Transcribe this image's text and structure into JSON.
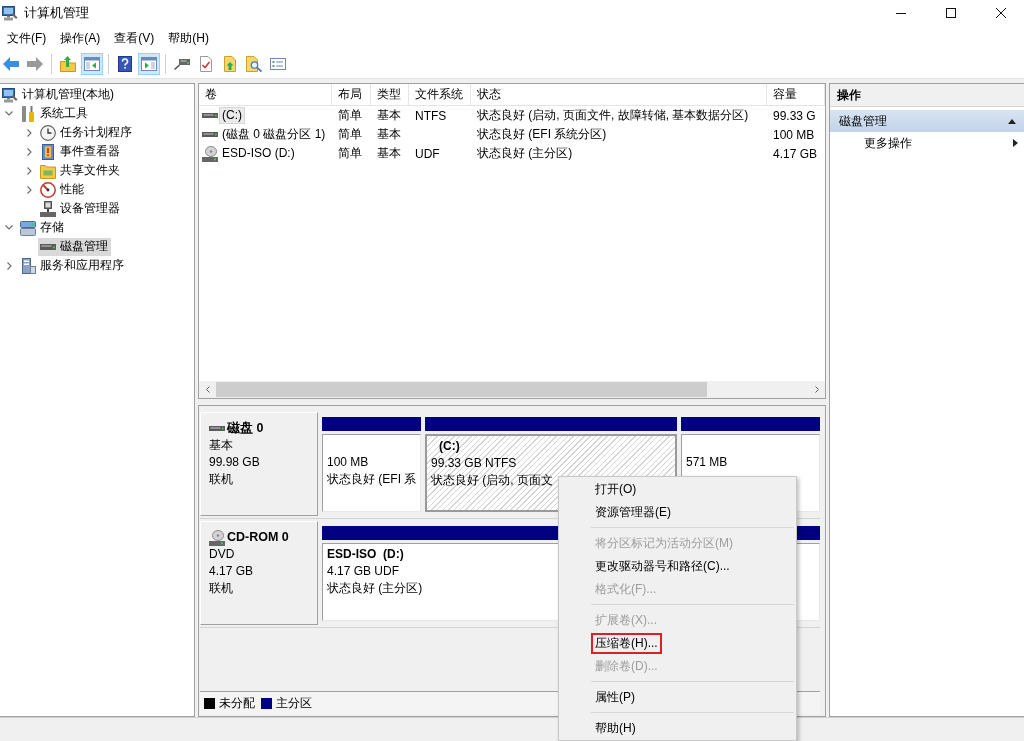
{
  "window": {
    "title": "计算机管理"
  },
  "menu_bar": [
    "文件(F)",
    "操作(A)",
    "查看(V)",
    "帮助(H)"
  ],
  "toolbar": [
    [
      {
        "kind": "back",
        "pressed": false,
        "disabled": false
      },
      {
        "kind": "forward",
        "pressed": false,
        "disabled": true
      }
    ],
    [
      {
        "kind": "up",
        "pressed": false,
        "disabled": false
      },
      {
        "kind": "console_tree",
        "pressed": true,
        "disabled": false
      }
    ],
    [
      {
        "kind": "help",
        "pressed": false,
        "disabled": false
      },
      {
        "kind": "action_pane",
        "pressed": true,
        "disabled": false
      }
    ],
    [
      {
        "kind": "connect",
        "pressed": false,
        "disabled": false
      },
      {
        "kind": "check",
        "pressed": false,
        "disabled": false
      },
      {
        "kind": "import",
        "pressed": false,
        "disabled": false
      },
      {
        "kind": "search",
        "pressed": false,
        "disabled": false
      },
      {
        "kind": "properties",
        "pressed": false,
        "disabled": false
      }
    ]
  ],
  "tree": [
    {
      "label": "计算机管理(本地)",
      "kind": "console",
      "selected": false,
      "children": [
        {
          "label": "系统工具",
          "kind": "tools",
          "selected": false,
          "expanded": true,
          "children": [
            {
              "label": "任务计划程序",
              "kind": "scheduler",
              "selected": false,
              "expanded": false
            },
            {
              "label": "事件查看器",
              "kind": "events",
              "selected": false,
              "expanded": false
            },
            {
              "label": "共享文件夹",
              "kind": "shares",
              "selected": false,
              "expanded": false
            },
            {
              "label": "性能",
              "kind": "performance",
              "selected": false,
              "expanded": false
            },
            {
              "label": "设备管理器",
              "kind": "devices",
              "selected": false
            }
          ]
        },
        {
          "label": "存储",
          "kind": "storage",
          "selected": false,
          "expanded": true,
          "children": [
            {
              "label": "磁盘管理",
              "kind": "disks",
              "selected": true
            }
          ]
        },
        {
          "label": "服务和应用程序",
          "kind": "services",
          "selected": false,
          "expanded": false
        }
      ]
    }
  ],
  "volume_table": {
    "columns": [
      "卷",
      "布局",
      "类型",
      "文件系统",
      "状态",
      "容量"
    ],
    "rows": [
      {
        "kind": "disk",
        "selected": true,
        "volume": "(C:)",
        "layout": "简单",
        "type": "基本",
        "file_system": "NTFS",
        "status": "状态良好 (启动, 页面文件, 故障转储, 基本数据分区)",
        "capacity": "99.33 G"
      },
      {
        "kind": "disk",
        "selected": false,
        "volume": "(磁盘 0 磁盘分区 1)",
        "layout": "简单",
        "type": "基本",
        "status": "状态良好 (EFI 系统分区)",
        "capacity": "100 MB"
      },
      {
        "kind": "optical",
        "selected": false,
        "volume": "ESD-ISO (D:)",
        "layout": "简单",
        "type": "基本",
        "file_system": "UDF",
        "status": "状态良好 (主分区)",
        "capacity": "4.17 GB"
      }
    ]
  },
  "disks": [
    {
      "kind": "disk",
      "name": "磁盘 0",
      "type": "基本",
      "size": "99.98 GB",
      "status": "联机",
      "partitions": [
        {
          "size": "100 MB",
          "status": "状态良好 (EFI 系",
          "selected": false
        },
        {
          "name": "(C:)",
          "size": "99.33 GB NTFS",
          "status": "状态良好 (启动, 页面文",
          "selected": true
        },
        {
          "size": "571 MB",
          "selected": false
        }
      ]
    },
    {
      "kind": "optical",
      "name": "CD-ROM 0",
      "type": "DVD",
      "size": "4.17 GB",
      "status": "联机",
      "partitions": [
        {
          "name": "ESD-ISO  (D:)",
          "size": "4.17 GB UDF",
          "status": "状态良好 (主分区)",
          "selected": false
        }
      ]
    }
  ],
  "legend": [
    {
      "label": "未分配",
      "color": "#000000"
    },
    {
      "label": "主分区",
      "color": "#000080"
    }
  ],
  "actions": {
    "title": "操作",
    "sections": [
      {
        "title": "磁盘管理",
        "expanded": true,
        "items": [
          {
            "label": "更多操作",
            "submenu": true
          }
        ]
      }
    ]
  },
  "context_menu": {
    "groups": [
      [
        {
          "label": "打开(O)",
          "disabled": false,
          "highlighted": false
        },
        {
          "label": "资源管理器(E)",
          "disabled": false,
          "highlighted": false
        }
      ],
      [
        {
          "label": "将分区标记为活动分区(M)",
          "disabled": true,
          "highlighted": false
        },
        {
          "label": "更改驱动器号和路径(C)...",
          "disabled": false,
          "highlighted": false
        },
        {
          "label": "格式化(F)...",
          "disabled": true,
          "highlighted": false
        }
      ],
      [
        {
          "label": "扩展卷(X)...",
          "disabled": true,
          "highlighted": false
        },
        {
          "label": "压缩卷(H)...",
          "disabled": false,
          "highlighted": true
        },
        {
          "label": "删除卷(D)...",
          "disabled": true,
          "highlighted": false
        }
      ],
      [
        {
          "label": "属性(P)",
          "disabled": false,
          "highlighted": false
        }
      ],
      [
        {
          "label": "帮助(H)",
          "disabled": false,
          "highlighted": false
        }
      ]
    ]
  }
}
